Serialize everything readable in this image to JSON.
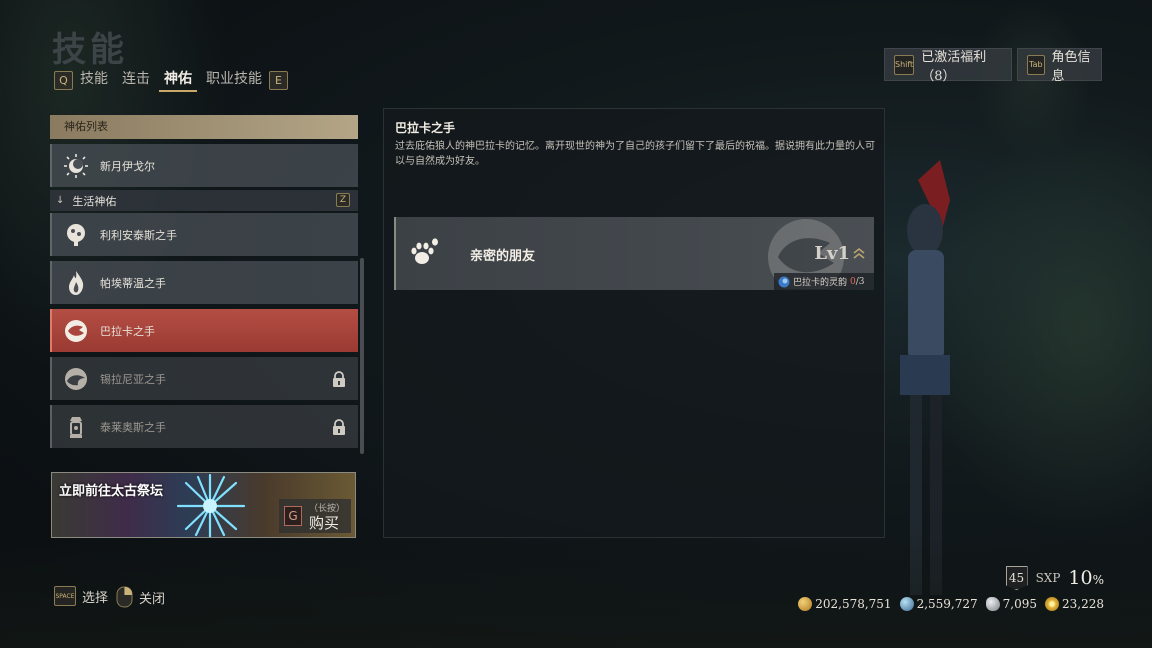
{
  "page": {
    "title": "技能"
  },
  "tabs": {
    "prev_key": "Q",
    "next_key": "E",
    "items": [
      {
        "label": "技能",
        "active": false
      },
      {
        "label": "连击",
        "active": false
      },
      {
        "label": "神佑",
        "active": true
      },
      {
        "label": "职业技能",
        "active": false
      }
    ]
  },
  "top_buttons": {
    "benefits": {
      "key": "Shift",
      "label": "已激活福利（8）"
    },
    "character": {
      "key": "Tab",
      "label": "角色信息"
    }
  },
  "list": {
    "header": "神佑列表",
    "top_item": {
      "label": "新月伊戈尔",
      "icon": "moon-sun-icon"
    },
    "group": {
      "label": "生活神佑",
      "key": "Z"
    },
    "items": [
      {
        "label": "利利安泰斯之手",
        "icon": "tree-icon",
        "locked": false,
        "selected": false
      },
      {
        "label": "帕埃蒂温之手",
        "icon": "flame-icon",
        "locked": false,
        "selected": false
      },
      {
        "label": "巴拉卡之手",
        "icon": "wolf-icon",
        "locked": false,
        "selected": true
      },
      {
        "label": "锡拉尼亚之手",
        "icon": "serpent-icon",
        "locked": true,
        "selected": false
      },
      {
        "label": "泰莱奥斯之手",
        "icon": "lantern-icon",
        "locked": true,
        "selected": false
      }
    ]
  },
  "banner": {
    "title": "立即前往太古祭坛",
    "buy_key": "G",
    "buy_hint": "（长按）",
    "buy_label": "购买"
  },
  "detail": {
    "title": "巴拉卡之手",
    "description": "过去庇佑狼人的神巴拉卡的记忆。离开现世的神为了自己的孩子们留下了最后的祝福。据说拥有此力量的人可以与自然成为好友。",
    "skill": {
      "name": "亲密的朋友",
      "icon": "paw-icon",
      "level": "Lv1",
      "resource_label": "巴拉卡的灵韵",
      "resource_current": "0",
      "resource_max": "/3"
    }
  },
  "hints": {
    "select": {
      "key": "SPACE",
      "label": "选择"
    },
    "close": {
      "key": "mouse-right-icon",
      "label": "关闭"
    }
  },
  "status": {
    "level": "45",
    "sxp_label": "SXP",
    "sxp_value": "10",
    "sxp_unit": "%",
    "currencies": [
      {
        "icon": "gold-coin-icon",
        "value": "202,578,751",
        "color": "#d9a63a"
      },
      {
        "icon": "blue-gem-icon",
        "value": "2,559,727",
        "color": "#6aa6c8"
      },
      {
        "icon": "silver-shard-icon",
        "value": "7,095",
        "color": "#b8bcc0"
      },
      {
        "icon": "gold-flower-icon",
        "value": "23,228",
        "color": "#e0b23a"
      }
    ]
  },
  "colors": {
    "selected_item": "#b44e44",
    "accent_gold": "#c9a86a"
  }
}
